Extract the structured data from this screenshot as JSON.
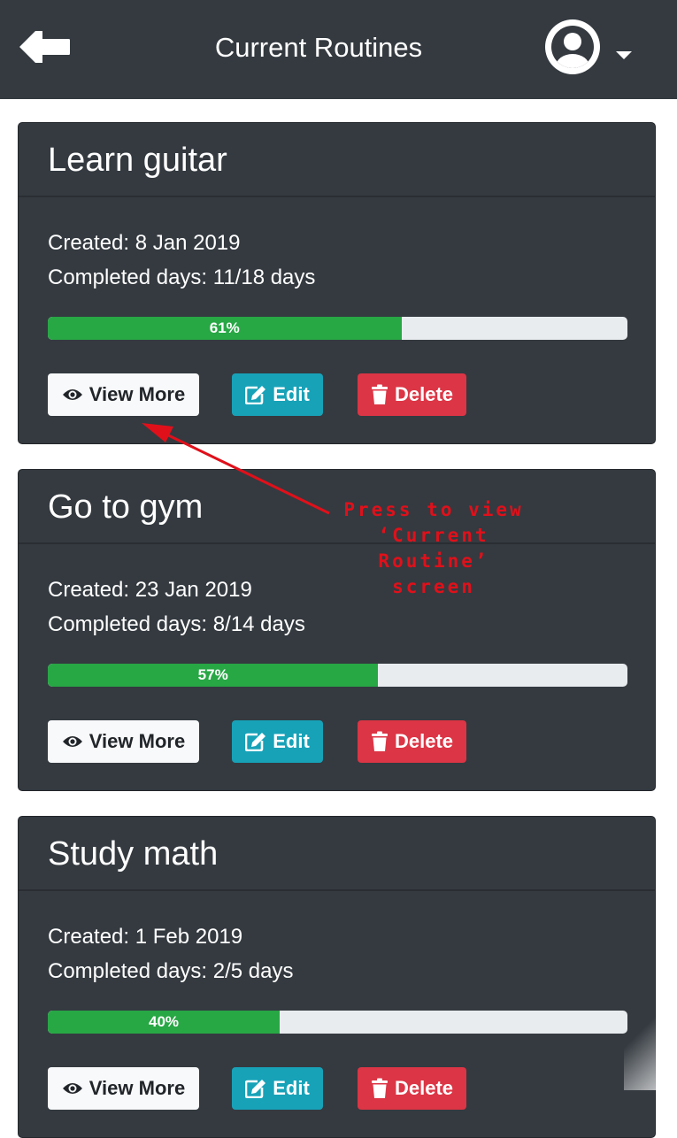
{
  "header": {
    "title": "Current Routines",
    "back_icon": "arrow-left-icon",
    "avatar_icon": "user-circle-icon",
    "menu_icon": "caret-down-icon",
    "background": "#343a40"
  },
  "routines": [
    {
      "title": "Learn guitar",
      "created": "Created: 8 Jan 2019",
      "completed": "Completed days: 11/18 days",
      "progress_percent": 61,
      "progress_label": "61%"
    },
    {
      "title": "Go to gym",
      "created": "Created: 23 Jan 2019",
      "completed": "Completed days: 8/14 days",
      "progress_percent": 57,
      "progress_label": "57%"
    },
    {
      "title": "Study math",
      "created": "Created: 1 Feb 2019",
      "completed": "Completed days: 2/5 days",
      "progress_percent": 40,
      "progress_label": "40%"
    }
  ],
  "buttons": {
    "view_more": "View More",
    "edit": "Edit",
    "delete": "Delete",
    "view_icon": "eye-icon",
    "edit_icon": "edit-icon",
    "delete_icon": "trash-icon"
  },
  "annotation": {
    "line1": "Press to view",
    "line2": "‘Current Routine’",
    "line3": "screen",
    "color": "#e0101a"
  },
  "colors": {
    "progress_fill": "#28a745",
    "progress_track": "#e9ecef",
    "edit": "#17a2b8",
    "delete": "#dc3545",
    "view": "#f8f9fa",
    "card": "#343a40"
  }
}
